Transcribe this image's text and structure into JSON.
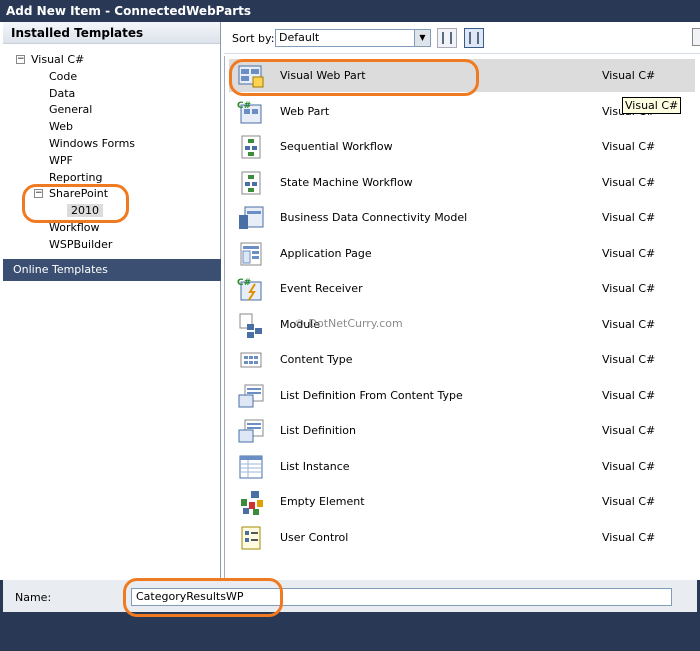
{
  "window": {
    "title": "Add New Item - ConnectedWebParts"
  },
  "left_panel": {
    "installed_header": "Installed Templates",
    "tree": [
      {
        "label": "Visual C#",
        "level": 0,
        "expander": "−"
      },
      {
        "label": "Code",
        "level": 1
      },
      {
        "label": "Data",
        "level": 1
      },
      {
        "label": "General",
        "level": 1
      },
      {
        "label": "Web",
        "level": 1
      },
      {
        "label": "Windows Forms",
        "level": 1
      },
      {
        "label": "WPF",
        "level": 1
      },
      {
        "label": "Reporting",
        "level": 1
      },
      {
        "label": "SharePoint",
        "level": 1,
        "expander": "−"
      },
      {
        "label": "2010",
        "level": 2,
        "selected": true
      },
      {
        "label": "Workflow",
        "level": 1
      },
      {
        "label": "WSPBuilder",
        "level": 1
      }
    ],
    "online_templates": "Online Templates"
  },
  "sort": {
    "label": "Sort by:",
    "value": "Default"
  },
  "templates": [
    {
      "name": "Visual Web Part",
      "lang": "Visual C#",
      "icon": "visual-web-part-icon",
      "selected": true
    },
    {
      "name": "Web Part",
      "lang": "Visual C#",
      "icon": "web-part-icon"
    },
    {
      "name": "Sequential Workflow",
      "lang": "Visual C#",
      "icon": "sequential-workflow-icon"
    },
    {
      "name": "State Machine Workflow",
      "lang": "Visual C#",
      "icon": "state-machine-workflow-icon"
    },
    {
      "name": "Business Data Connectivity Model",
      "lang": "Visual C#",
      "icon": "bdc-model-icon"
    },
    {
      "name": "Application Page",
      "lang": "Visual C#",
      "icon": "application-page-icon"
    },
    {
      "name": "Event Receiver",
      "lang": "Visual C#",
      "icon": "event-receiver-icon"
    },
    {
      "name": "Module",
      "lang": "Visual C#",
      "icon": "module-icon"
    },
    {
      "name": "Content Type",
      "lang": "Visual C#",
      "icon": "content-type-icon"
    },
    {
      "name": "List Definition From Content Type",
      "lang": "Visual C#",
      "icon": "list-definition-content-type-icon"
    },
    {
      "name": "List Definition",
      "lang": "Visual C#",
      "icon": "list-definition-icon"
    },
    {
      "name": "List Instance",
      "lang": "Visual C#",
      "icon": "list-instance-icon"
    },
    {
      "name": "Empty Element",
      "lang": "Visual C#",
      "icon": "empty-element-icon"
    },
    {
      "name": "User Control",
      "lang": "Visual C#",
      "icon": "user-control-icon"
    }
  ],
  "tooltip": "Visual C#",
  "watermark": "© DotNetCurry.com",
  "name_field": {
    "label": "Name:",
    "value": "CategoryResultsWP"
  },
  "colors": {
    "highlight": "#f07a22",
    "titlebar": "#293955",
    "online": "#3b4f72"
  }
}
